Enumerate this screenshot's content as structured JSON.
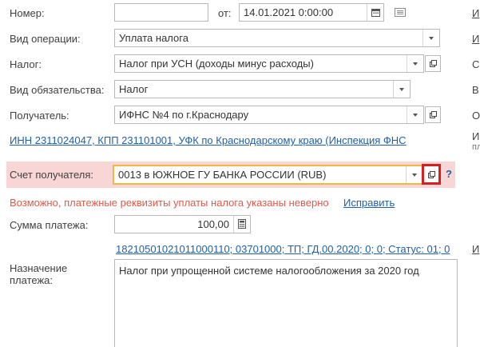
{
  "form": {
    "number": {
      "label": "Номер:",
      "value": ""
    },
    "date": {
      "from_label": "от:",
      "value": "14.01.2021  0:00:00"
    },
    "operation": {
      "label": "Вид операции:",
      "value": "Уплата налога"
    },
    "tax": {
      "label": "Налог:",
      "value": "Налог при УСН (доходы минус расходы)"
    },
    "obligation": {
      "label": "Вид обязательства:",
      "value": "Налог"
    },
    "recipient": {
      "label": "Получатель:",
      "value": "ИФНС №4 по г.Краснодару"
    },
    "recipient_details_link": "ИНН 2311024047, КПП 231101001, УФК по Краснодарскому краю (Инспекция ФНС",
    "recipient_account": {
      "label": "Счет получателя:",
      "value": "0013 в ЮЖНОЕ ГУ БАНКА РОССИИ (RUB)",
      "help": "?"
    },
    "warning": {
      "text": "Возможно, платежные реквизиты уплаты налога указаны неверно",
      "fix_link": "Исправить"
    },
    "amount": {
      "label": "Сумма платежа:",
      "value": "100,00"
    },
    "budget_details_link": "18210501021011000110; 03701000; ТП; ГД.00.2020; 0; 0; Статус: 01; 0",
    "purpose": {
      "label_line1": "Назначение",
      "label_line2": "платежа:",
      "value": "Налог при упрощенной системе налогообложения за 2020 год"
    }
  },
  "right_column": {
    "items": [
      "И",
      "С",
      "В",
      "О",
      "И",
      "пл"
    ]
  },
  "colors": {
    "accent_border": "#f0b840",
    "highlight_row": "#f9d6d6",
    "warning_text": "#e05a4a",
    "link": "#2060a8",
    "callout_red": "#d42020"
  }
}
